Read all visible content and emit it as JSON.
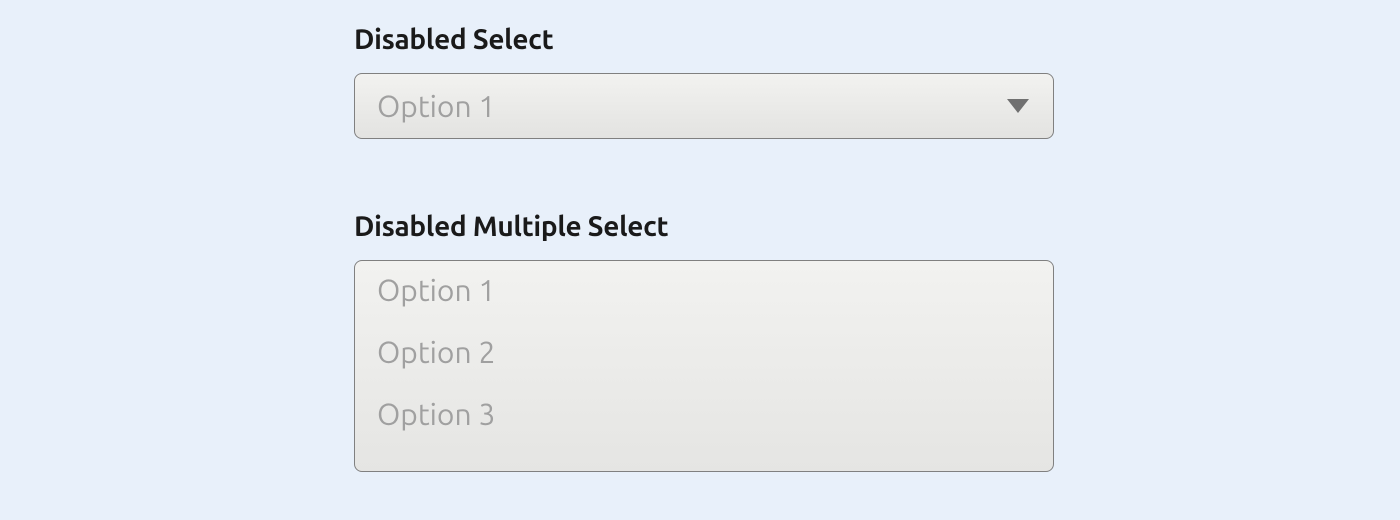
{
  "disabled_select": {
    "label": "Disabled Select",
    "value": "Option 1"
  },
  "disabled_multi_select": {
    "label": "Disabled Multiple Select",
    "options": {
      "0": "Option 1",
      "1": "Option 2",
      "2": "Option 3"
    }
  }
}
